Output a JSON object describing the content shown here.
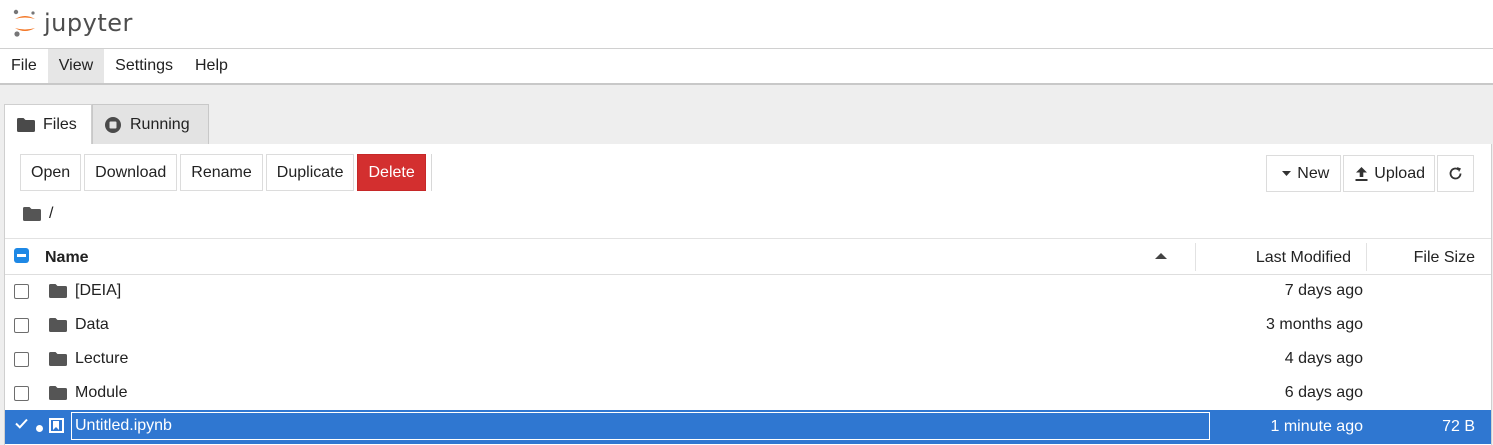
{
  "app": {
    "name": "jupyter"
  },
  "menu": {
    "items": [
      "File",
      "View",
      "Settings",
      "Help"
    ],
    "active": "View"
  },
  "tabs": [
    {
      "label": "Files",
      "icon": "folder-icon"
    },
    {
      "label": "Running",
      "icon": "stop-circle-icon"
    }
  ],
  "toolbar": {
    "open": "Open",
    "download": "Download",
    "rename": "Rename",
    "duplicate": "Duplicate",
    "delete": "Delete",
    "new": "New",
    "upload": "Upload",
    "refresh_icon": "refresh-icon"
  },
  "breadcrumb": {
    "path": "/"
  },
  "table": {
    "headers": {
      "name": "Name",
      "modified": "Last Modified",
      "size": "File Size"
    },
    "sort": {
      "column": "Name",
      "direction": "ascending"
    },
    "rows": [
      {
        "name": "[DEIA]",
        "type": "folder",
        "modified": "7 days ago",
        "size": ""
      },
      {
        "name": "Data",
        "type": "folder",
        "modified": "3 months ago",
        "size": ""
      },
      {
        "name": "Lecture",
        "type": "folder",
        "modified": "4 days ago",
        "size": ""
      },
      {
        "name": "Module",
        "type": "folder",
        "modified": "6 days ago",
        "size": ""
      },
      {
        "name": "Untitled.ipynb",
        "type": "notebook",
        "modified": "1 minute ago",
        "size": "72 B",
        "selected": true,
        "running": true
      }
    ]
  },
  "colors": {
    "accent": "#2f77d1",
    "danger": "#d32f2f",
    "logo_orange": "#f37726"
  }
}
